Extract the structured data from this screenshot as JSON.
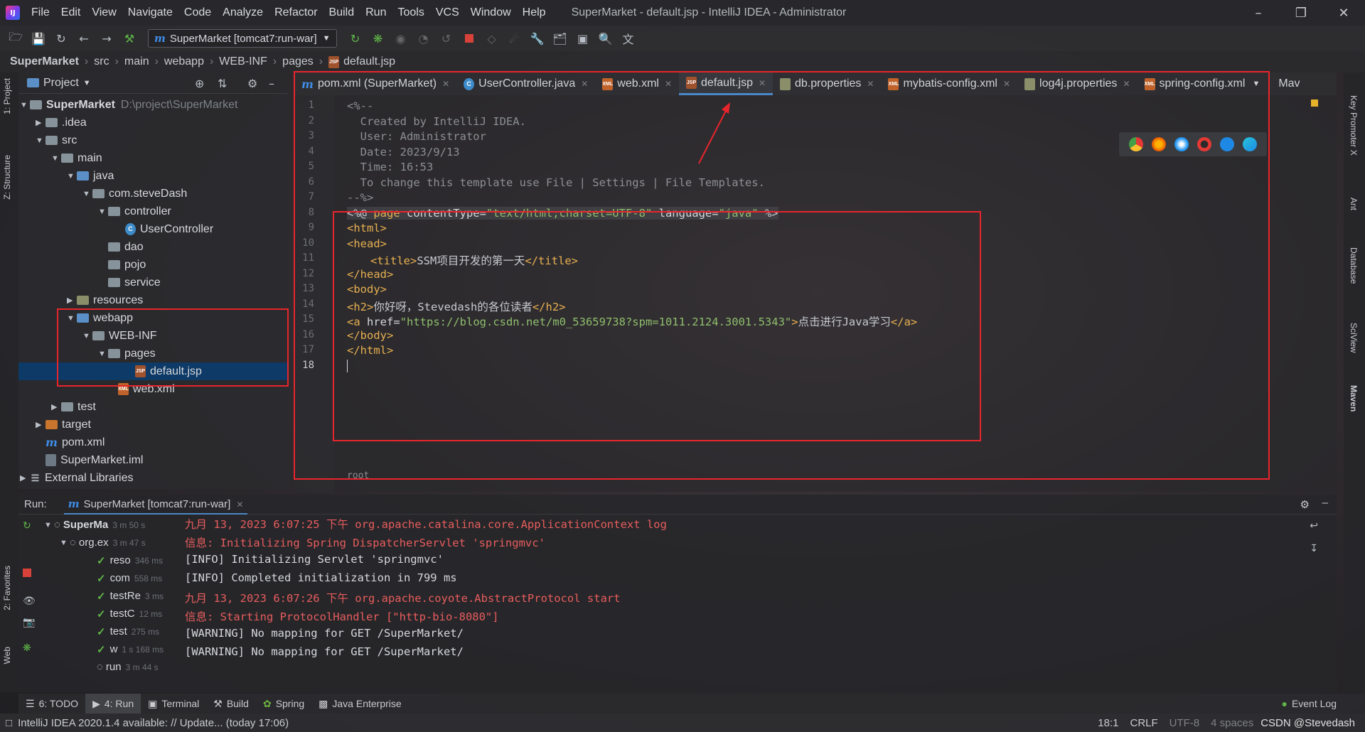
{
  "menu": [
    "File",
    "Edit",
    "View",
    "Navigate",
    "Code",
    "Analyze",
    "Refactor",
    "Build",
    "Run",
    "Tools",
    "VCS",
    "Window",
    "Help"
  ],
  "window_title": "SuperMarket - default.jsp - IntelliJ IDEA - Administrator",
  "run_config": "SuperMarket [tomcat7:run-war]",
  "breadcrumb": [
    "SuperMarket",
    "src",
    "main",
    "webapp",
    "WEB-INF",
    "pages",
    "default.jsp"
  ],
  "project": {
    "header": "Project",
    "root_name": "SuperMarket",
    "root_path": "D:\\project\\SuperMarket",
    "items": [
      ".idea",
      "src",
      "main",
      "java",
      "com.steveDash",
      "controller",
      "UserController",
      "dao",
      "pojo",
      "service",
      "resources",
      "webapp",
      "WEB-INF",
      "pages",
      "default.jsp",
      "web.xml",
      "test",
      "target",
      "pom.xml",
      "SuperMarket.iml",
      "External Libraries"
    ]
  },
  "left_tabs": [
    "1: Project",
    "Z: Structure",
    "2: Favorites",
    "Web"
  ],
  "right_tabs": [
    "Key Promoter X",
    "Ant",
    "Database",
    "SciView",
    "Maven"
  ],
  "right_top_label": "Mav",
  "tabs": [
    {
      "label": "pom.xml (SuperMarket)"
    },
    {
      "label": "UserController.java"
    },
    {
      "label": "web.xml"
    },
    {
      "label": "default.jsp"
    },
    {
      "label": "db.properties"
    },
    {
      "label": "mybatis-config.xml"
    },
    {
      "label": "log4j.properties"
    },
    {
      "label": "spring-config.xml"
    }
  ],
  "code": {
    "l1": "<%--",
    "l2": "  Created by IntelliJ IDEA.",
    "l3": "  User: Administrator",
    "l4": "  Date: 2023/9/13",
    "l5": "  Time: 16:53",
    "l6": "  To change this template use File | Settings | File Templates.",
    "l7": "--%>",
    "l8_pre": "<%@ ",
    "l8_kw": "page",
    "l8_a1": " contentType=",
    "l8_v1": "\"text/html;charset=UTF-8\"",
    "l8_a2": " language=",
    "l8_v2": "\"java\"",
    "l8_end": " %>",
    "l9": "<html>",
    "l10": "<head>",
    "l11_open": "<title>",
    "l11_text": "SSM项目开发的第一天",
    "l11_close": "</title>",
    "l12": "</head>",
    "l13": "<body>",
    "l14_open": "<h2>",
    "l14_text": "你好呀，Stevedash的各位读者",
    "l14_close": "</h2>",
    "l15_open": "<a",
    "l15_attr": " href=",
    "l15_val": "\"https://blog.csdn.net/m0_53659738?spm=1011.2124.3001.5343\"",
    "l15_gt": ">",
    "l15_text": "点击进行Java学习",
    "l15_close": "</a>",
    "l16": "</body>",
    "l17": "</html>",
    "footer_crumb": "root"
  },
  "run": {
    "label": "Run:",
    "config": "SuperMarket [tomcat7:run-war]",
    "tree": [
      {
        "name": "SuperMa",
        "time": "3 m 50 s"
      },
      {
        "name": "org.ex",
        "time": "3 m 47 s"
      },
      {
        "name": "reso",
        "time": "346 ms"
      },
      {
        "name": "com",
        "time": "558 ms"
      },
      {
        "name": "testRe",
        "time": "3 ms"
      },
      {
        "name": "testC",
        "time": "12 ms"
      },
      {
        "name": "test",
        "time": "275 ms"
      },
      {
        "name": "w",
        "time": "1 s 168 ms"
      },
      {
        "name": "run",
        "time": "3 m 44 s"
      }
    ],
    "console": [
      "九月 13, 2023 6:07:25 下午 org.apache.catalina.core.ApplicationContext log",
      "信息: Initializing Spring DispatcherServlet 'springmvc'",
      "[INFO] Initializing Servlet 'springmvc'",
      "[INFO] Completed initialization in 799 ms",
      "九月 13, 2023 6:07:26 下午 org.apache.coyote.AbstractProtocol start",
      "信息: Starting ProtocolHandler [\"http-bio-8080\"]",
      "[WARNING] No mapping for GET /SuperMarket/",
      "[WARNING] No mapping for GET /SuperMarket/"
    ]
  },
  "bottom_tools": [
    "6: TODO",
    "4: Run",
    "Terminal",
    "Build",
    "Spring",
    "Java Enterprise"
  ],
  "event_log": "Event Log",
  "status": {
    "message": "IntelliJ IDEA 2020.1.4 available: // Update... (today 17:06)",
    "position": "18:1",
    "line_sep": "CRLF",
    "encoding": "UTF-8",
    "indent": "4 spaces",
    "watermark": "CSDN @Stevedash"
  },
  "colors": {
    "highlight_box": "#e8252c",
    "selection": "#0d3a66",
    "keyword": "#e7b050",
    "string": "#8fbf6c"
  }
}
